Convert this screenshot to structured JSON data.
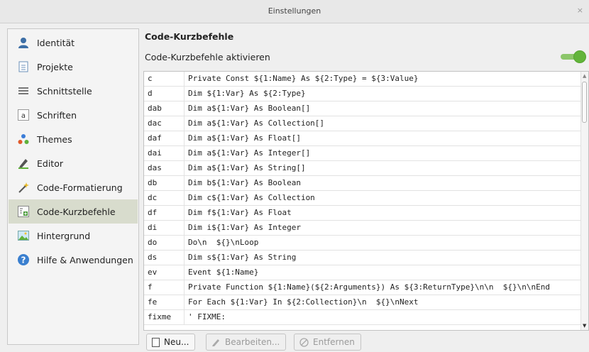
{
  "window": {
    "title": "Einstellungen",
    "close_glyph": "×"
  },
  "sidebar": {
    "items": [
      {
        "label": "Identität",
        "icon": "person-icon"
      },
      {
        "label": "Projekte",
        "icon": "project-file-icon"
      },
      {
        "label": "Schnittstelle",
        "icon": "interface-lines-icon"
      },
      {
        "label": "Schriften",
        "icon": "font-icon"
      },
      {
        "label": "Themes",
        "icon": "themes-dots-icon"
      },
      {
        "label": "Editor",
        "icon": "pen-icon"
      },
      {
        "label": "Code-Formatierung",
        "icon": "magic-wand-icon"
      },
      {
        "label": "Code-Kurzbefehle",
        "icon": "code-snippet-icon",
        "active": true
      },
      {
        "label": "Hintergrund",
        "icon": "image-icon"
      },
      {
        "label": "Hilfe & Anwendungen",
        "icon": "help-icon"
      }
    ]
  },
  "main": {
    "section_title": "Code-Kurzbefehle",
    "enable_label": "Code-Kurzbefehle aktivieren",
    "toggle_on": true,
    "colors": {
      "accent": "#62b43a",
      "selected_bg": "#d8dccd"
    }
  },
  "shortcuts": {
    "rows": [
      {
        "key": "c",
        "code": "Private Const ${1:Name} As ${2:Type} = ${3:Value}"
      },
      {
        "key": "d",
        "code": "Dim ${1:Var} As ${2:Type}"
      },
      {
        "key": "dab",
        "code": "Dim a${1:Var} As Boolean[]"
      },
      {
        "key": "dac",
        "code": "Dim a${1:Var} As Collection[]"
      },
      {
        "key": "daf",
        "code": "Dim a${1:Var} As Float[]"
      },
      {
        "key": "dai",
        "code": "Dim a${1:Var} As Integer[]"
      },
      {
        "key": "das",
        "code": "Dim a${1:Var} As String[]"
      },
      {
        "key": "db",
        "code": "Dim b${1:Var} As Boolean"
      },
      {
        "key": "dc",
        "code": "Dim c${1:Var} As Collection"
      },
      {
        "key": "df",
        "code": "Dim f${1:Var} As Float"
      },
      {
        "key": "di",
        "code": "Dim i${1:Var} As Integer"
      },
      {
        "key": "do",
        "code": "Do\\n  ${}\\nLoop"
      },
      {
        "key": "ds",
        "code": "Dim s${1:Var} As String"
      },
      {
        "key": "ev",
        "code": "Event ${1:Name}"
      },
      {
        "key": "f",
        "code": "Private Function ${1:Name}(${2:Arguments}) As ${3:ReturnType}\\n\\n  ${}\\n\\nEnd"
      },
      {
        "key": "fe",
        "code": "For Each ${1:Var} In ${2:Collection}\\n  ${}\\nNext"
      },
      {
        "key": "fixme",
        "code": "' FIXME:"
      }
    ]
  },
  "buttons": {
    "new": "Neu...",
    "edit": "Bearbeiten...",
    "remove": "Entfernen"
  }
}
